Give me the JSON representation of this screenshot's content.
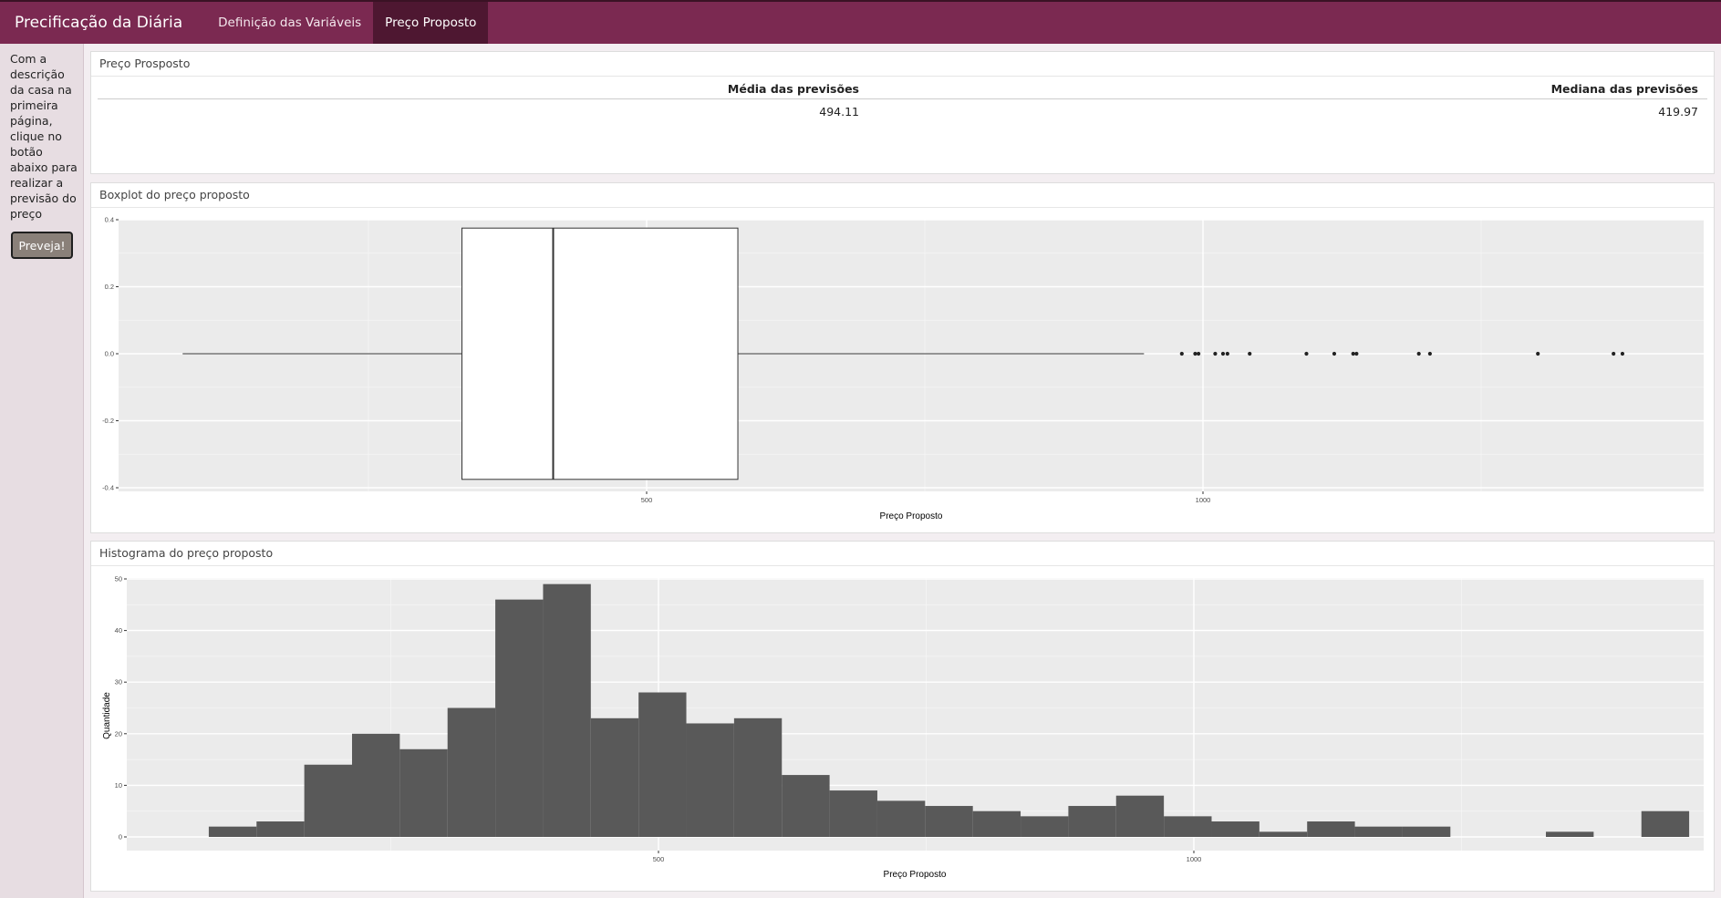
{
  "navbar": {
    "brand": "Precificação da Diária",
    "tabs": [
      {
        "label": "Definição das Variáveis"
      },
      {
        "label": "Preço Proposto"
      }
    ]
  },
  "sidebar": {
    "description": "Com a descrição da casa na primeira página, clique no botão abaixo para realizar a previsão do preço",
    "button_label": "Preveja!"
  },
  "summary": {
    "title": "Preço Prosposto",
    "headers": [
      "Média das previsões",
      "Mediana das previsões"
    ],
    "values": [
      "494.11",
      "419.97"
    ]
  },
  "boxplot": {
    "title": "Boxplot do preço proposto"
  },
  "histogram": {
    "title": "Histograma do preço proposto"
  },
  "colors": {
    "navbar": "#7b2951",
    "active_tab": "#4e1731",
    "panel_bg": "#ebebeb",
    "bar_fill": "#595959"
  },
  "chart_data": [
    {
      "type": "boxplot",
      "xlabel": "Preço Proposto",
      "ylabel": "",
      "xticks": [
        500,
        1000
      ],
      "yticks": [
        "-0.4",
        "-0.2",
        "0.0",
        "0.2",
        "0.4"
      ],
      "ylim": [
        -0.4,
        0.4
      ],
      "grid": true,
      "whisker_low": 83,
      "q1": 334,
      "median": 416,
      "q3": 582,
      "whisker_high": 947,
      "outliers": [
        981,
        993,
        996,
        1011,
        1018,
        1022,
        1042,
        1093,
        1118,
        1135,
        1138,
        1194,
        1204,
        1301,
        1369,
        1377
      ]
    },
    {
      "type": "bar",
      "xlabel": "Preço Proposto",
      "ylabel": "Quantidade",
      "xticks": [
        500,
        1000
      ],
      "yticks": [
        0,
        10,
        20,
        30,
        40,
        50
      ],
      "ylim": [
        0,
        50
      ],
      "grid": true,
      "bin_width": 44.6,
      "bin_start": 80,
      "values": [
        2,
        3,
        14,
        20,
        17,
        25,
        46,
        49,
        23,
        28,
        22,
        23,
        12,
        9,
        7,
        6,
        5,
        4,
        6,
        8,
        4,
        3,
        1,
        3,
        2,
        2,
        0,
        0,
        1,
        0,
        5
      ]
    }
  ]
}
